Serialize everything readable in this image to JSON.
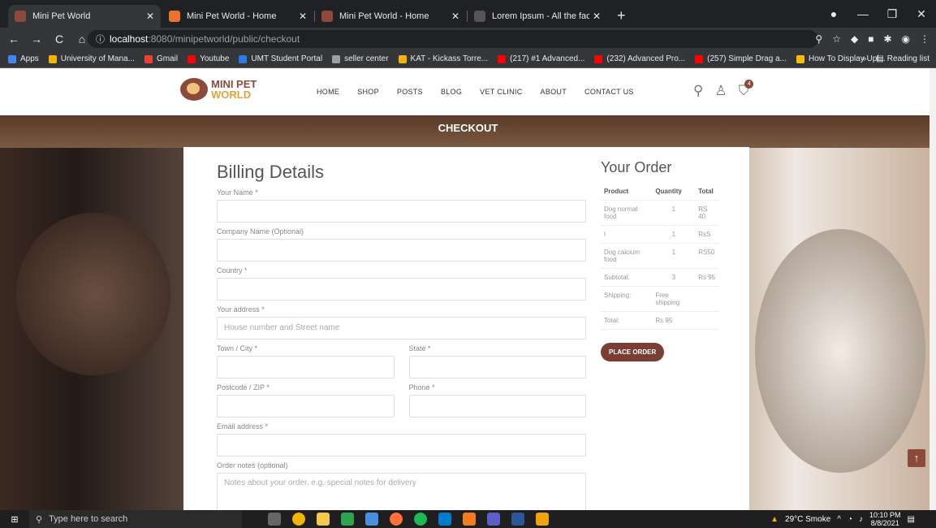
{
  "browser": {
    "tabs": [
      {
        "title": "Mini Pet World",
        "active": true,
        "color": "#8b4a3a"
      },
      {
        "title": "Mini Pet World - Home",
        "active": false,
        "color": "#e9732b"
      },
      {
        "title": "Mini Pet World - Home",
        "active": false,
        "color": "#8b4a3a"
      },
      {
        "title": "Lorem Ipsum - All the facts - Lip:",
        "active": false,
        "color": "#555555"
      }
    ],
    "new_tab": "+",
    "url_host": "localhost",
    "url_path": ":8080/minipetworld/public/checkout",
    "bookmarks": [
      {
        "label": "Apps",
        "color": "#4285f4"
      },
      {
        "label": "University of Mana...",
        "color": "#f4b400"
      },
      {
        "label": "Gmail",
        "color": "#ea4335"
      },
      {
        "label": "Youtube",
        "color": "#ff0000"
      },
      {
        "label": "UMT Student Portal",
        "color": "#2c7be5"
      },
      {
        "label": "seller center",
        "color": "#9aa0a6"
      },
      {
        "label": "KAT - Kickass Torre...",
        "color": "#f4b400"
      },
      {
        "label": "(217) #1 Advanced...",
        "color": "#ff0000"
      },
      {
        "label": "(232) Advanced Pro...",
        "color": "#ff0000"
      },
      {
        "label": "(257) Simple Drag a...",
        "color": "#ff0000"
      },
      {
        "label": "How To Display Upl...",
        "color": "#fbbc05"
      }
    ],
    "reading_list": "Reading list",
    "more_bookmarks": "»"
  },
  "site": {
    "logo_line1": "MINI PET",
    "logo_line2": "WORLD",
    "menu": [
      "HOME",
      "SHOP",
      "POSTS",
      "BLOG",
      "VET CLINIC",
      "ABOUT",
      "CONTACT US"
    ],
    "cart_count": "4",
    "page_title": "CHECKOUT"
  },
  "billing": {
    "heading": "Billing Details",
    "name_label": "Your Name *",
    "company_label": "Company Name (Optional)",
    "country_label": "Country *",
    "address_label": "Your address *",
    "address_placeholder": "House number and Street name",
    "town_label": "Town / City *",
    "state_label": "State *",
    "postcode_label": "Postcode / ZIP *",
    "phone_label": "Phone *",
    "email_label": "Email address *",
    "notes_label": "Order notes (optional)",
    "notes_placeholder": "Notes about your order, e.g. special notes for delivery"
  },
  "order": {
    "heading": "Your Order",
    "columns": [
      "Product",
      "Quantity",
      "Total"
    ],
    "rows": [
      {
        "product": "Dog normal food",
        "qty": "1",
        "total": "RS 40"
      },
      {
        "product": "l",
        "qty": "1",
        "total": "RsS"
      },
      {
        "product": "Dog calcium food",
        "qty": "1",
        "total": "RS50"
      }
    ],
    "subtotal_label": "Subtotal:",
    "subtotal_qty": "3",
    "subtotal_total": "Rs 95",
    "shipping_label": "Shipping:",
    "shipping_value": "Free shipping",
    "total_label": "Total:",
    "total_value": "Rs 95",
    "place_order": "PLACE ORDER"
  },
  "taskbar": {
    "search_placeholder": "Type here to search",
    "weather": "29°C Smoke",
    "time": "10:10 PM",
    "date": "8/8/2021"
  }
}
